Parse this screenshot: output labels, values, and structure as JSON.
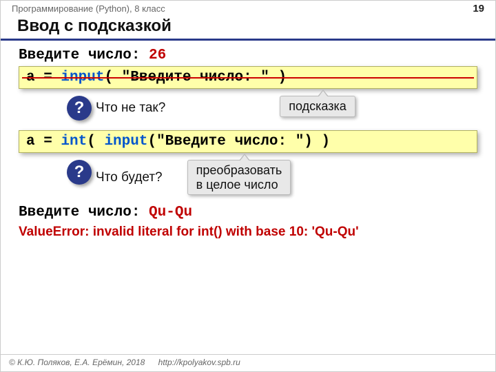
{
  "header": {
    "course": "Программирование (Python), 8 класс",
    "page": "19"
  },
  "title": "Ввод с подсказкой",
  "prompt1": {
    "label": "Введите число: ",
    "value": "26"
  },
  "code1": {
    "a_eq": "a = ",
    "input_kw": "input",
    "rest": "( \"Введите число: \" )"
  },
  "q1": {
    "mark": "?",
    "text": "Что не так?"
  },
  "callout1": "подсказка",
  "code2": {
    "a_eq": "a = ",
    "int_kw": "int",
    "paren1": "( ",
    "input_kw": "input",
    "rest": "(\"Введите число: \") )"
  },
  "q2": {
    "mark": "?",
    "text": "Что будет?"
  },
  "callout2_l1": "преобразовать",
  "callout2_l2": "в целое число",
  "prompt2": {
    "label": "Введите число: ",
    "value": "Qu-Qu"
  },
  "error": "ValueError: invalid literal for int() with base 10: 'Qu-Qu'",
  "footer": {
    "copyright": "© К.Ю. Поляков, Е.А. Ерёмин, 2018",
    "url": "http://kpolyakov.spb.ru"
  }
}
